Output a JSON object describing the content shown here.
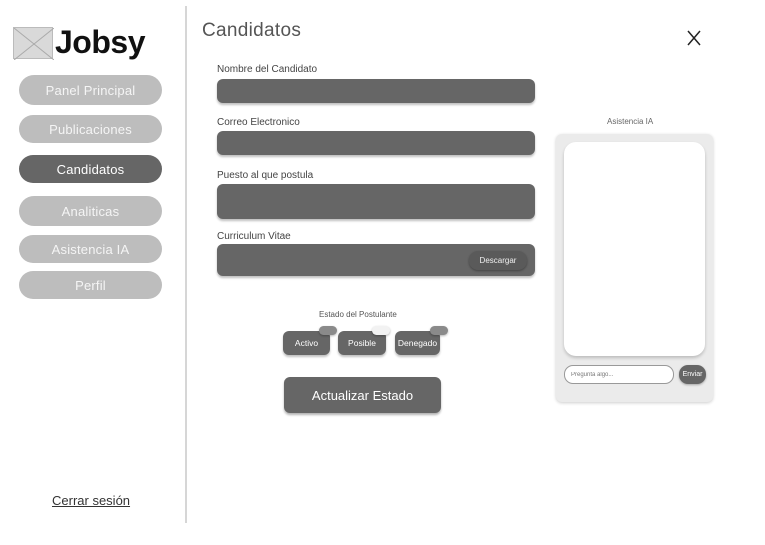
{
  "app": {
    "name": "Jobsy"
  },
  "sidebar": {
    "items": [
      {
        "label": "Panel Principal",
        "active": false
      },
      {
        "label": "Publicaciones",
        "active": false
      },
      {
        "label": "Candidatos",
        "active": true
      },
      {
        "label": "Analiticas",
        "active": false
      },
      {
        "label": "Asistencia IA",
        "active": false
      },
      {
        "label": "Perfil",
        "active": false
      }
    ],
    "logout": "Cerrar sesión"
  },
  "page": {
    "title": "Candidatos"
  },
  "form": {
    "name_label": "Nombre del Candidato",
    "email_label": "Correo Electronico",
    "position_label": "Puesto al que postula",
    "cv_label": "Curriculum Vitae",
    "download_label": "Descargar"
  },
  "status": {
    "title": "Estado del Postulante",
    "options": [
      {
        "label": "Activo",
        "toggle_color": "#8a8a8a"
      },
      {
        "label": "Posible",
        "toggle_color": "#f2f2f2"
      },
      {
        "label": "Denegado",
        "toggle_color": "#8a8a8a"
      }
    ],
    "update_label": "Actualizar Estado"
  },
  "ai": {
    "title": "Asistencia IA",
    "placeholder": "Pregunta algo...",
    "send_label": "Enviar"
  },
  "colors": {
    "primary": "#666666",
    "muted": "#bdbdbd"
  }
}
